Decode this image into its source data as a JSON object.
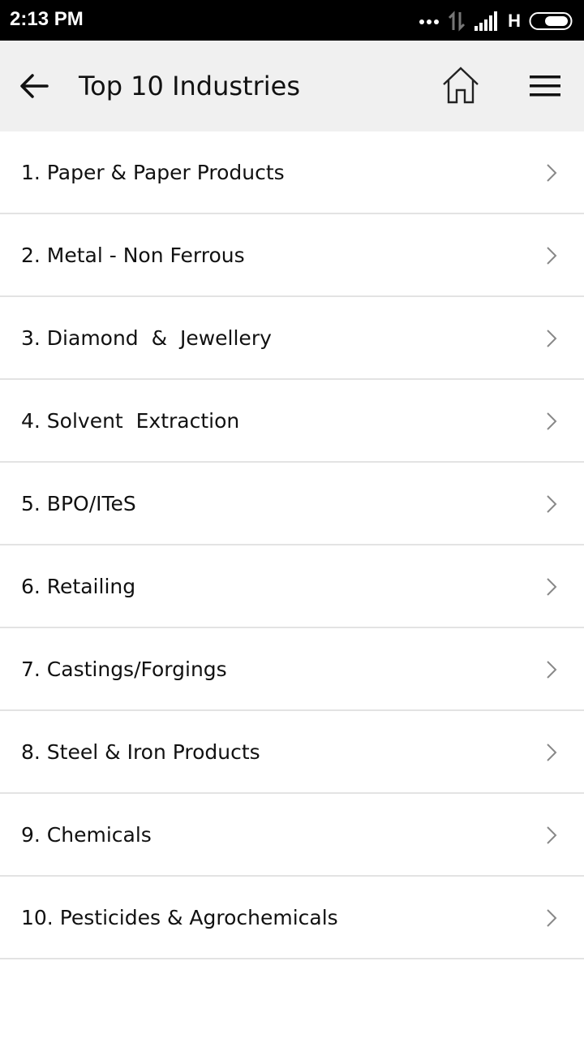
{
  "status_bar": {
    "time": "2:13 PM",
    "network_type": "H",
    "icons": [
      "more-dots-icon",
      "data-transfer-icon",
      "signal-icon",
      "battery-icon"
    ]
  },
  "app_bar": {
    "title": "Top 10 Industries",
    "background": "#f0f0f0",
    "icons": [
      "back-arrow-icon",
      "home-icon",
      "menu-icon"
    ]
  },
  "industries": [
    {
      "label": "1. Paper & Paper Products"
    },
    {
      "label": "2. Metal - Non Ferrous"
    },
    {
      "label": "3. Diamond  &  Jewellery"
    },
    {
      "label": "4. Solvent  Extraction"
    },
    {
      "label": "5. BPO/ITeS"
    },
    {
      "label": "6. Retailing"
    },
    {
      "label": "7. Castings/Forgings"
    },
    {
      "label": "8. Steel & Iron Products"
    },
    {
      "label": "9. Chemicals"
    },
    {
      "label": "10. Pesticides & Agrochemicals"
    }
  ],
  "colors": {
    "status_bar": "#000000",
    "divider": "#e3e3e3",
    "chevron": "#888888",
    "text": "#111111"
  }
}
